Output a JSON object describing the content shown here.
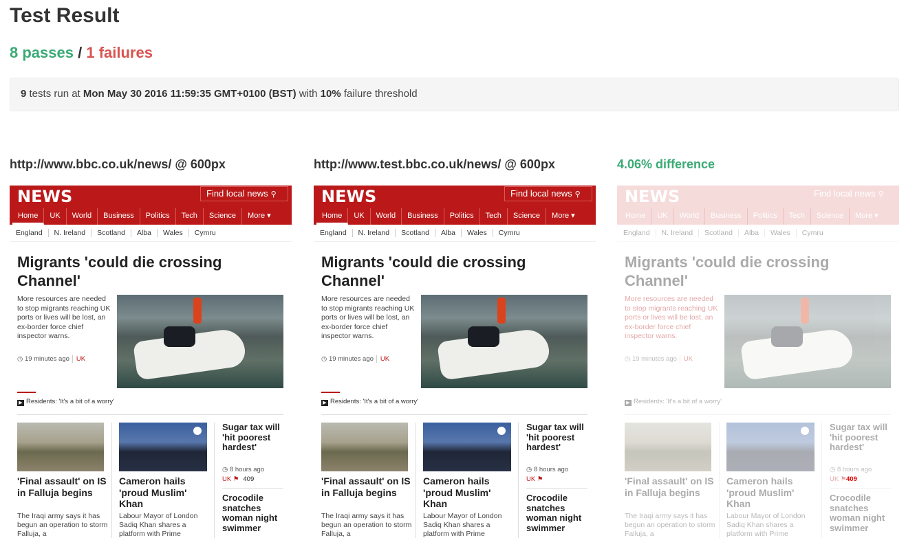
{
  "page": {
    "title": "Test Result",
    "passes": "8 passes",
    "separator": "/",
    "failures": "1 failures"
  },
  "run": {
    "count": "9",
    "text1": "tests run at",
    "date": "Mon May 30 2016 11:59:35 GMT+0100 (BST)",
    "text2": "with",
    "threshold": "10%",
    "text3": "failure threshold"
  },
  "columns": {
    "reference": "http://www.bbc.co.uk/news/ @ 600px",
    "test": "http://www.test.bbc.co.uk/news/ @ 600px",
    "difference": "4.06% difference"
  },
  "screenshot": {
    "logo": "NEWS",
    "find_local": "Find local news",
    "nav": [
      "Home",
      "UK",
      "World",
      "Business",
      "Politics",
      "Tech",
      "Science",
      "More ▾"
    ],
    "subnav": [
      "England",
      "N. Ireland",
      "Scotland",
      "Alba",
      "Wales",
      "Cymru"
    ],
    "headline": "Migrants 'could die crossing Channel'",
    "summary": "More resources are needed to stop migrants reaching UK ports or lives will be lost, an ex-border force chief inspector warns.",
    "time": "19 minutes ago",
    "section": "UK",
    "residents": "Residents: 'It's a bit of a worry'",
    "card1_title": "'Final assault' on IS in Falluja begins",
    "card1_text": "The Iraqi army says it has begun an operation to storm Falluja, a",
    "card2_title": "Cameron hails 'proud Muslim' Khan",
    "card2_text": "Labour Mayor of London Sadiq Khan shares a platform with Prime",
    "side1_title": "Sugar tax will 'hit poorest hardest'",
    "side_time": "8 hours ago",
    "side_section": "UK",
    "comments": "409",
    "side2_title": "Crocodile snatches woman night swimmer"
  }
}
